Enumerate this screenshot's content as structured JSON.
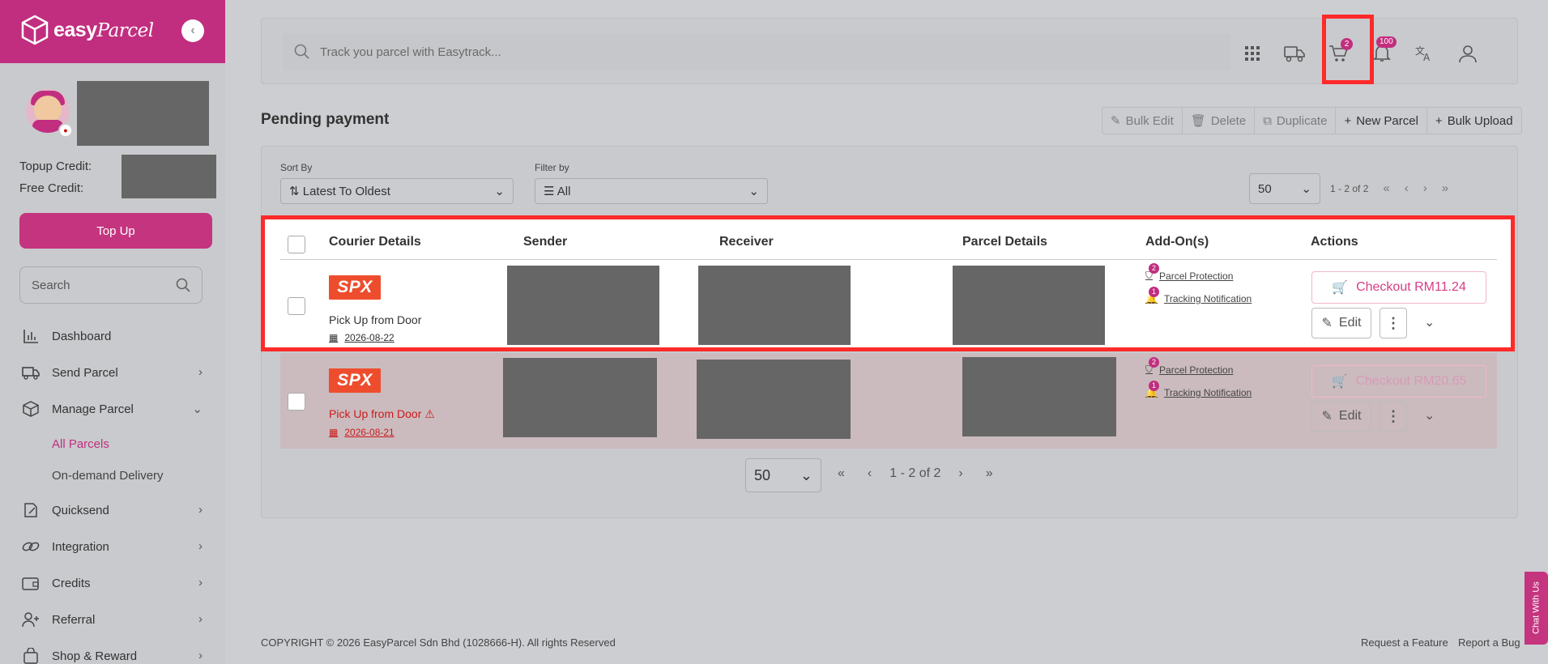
{
  "brand": {
    "name": "easyParcel",
    "name_plain": "easy",
    "name_italic": "Parcel"
  },
  "sidebar": {
    "topup_label": "Topup Credit:",
    "free_label": "Free Credit:",
    "topup_button": "Top Up",
    "search_placeholder": "Search",
    "nav": {
      "dashboard": "Dashboard",
      "send_parcel": "Send Parcel",
      "manage_parcel": "Manage Parcel",
      "all_parcels": "All Parcels",
      "on_demand": "On-demand Delivery",
      "quicksend": "Quicksend",
      "integration": "Integration",
      "credits": "Credits",
      "referral": "Referral",
      "shop_reward": "Shop & Reward"
    }
  },
  "topbar": {
    "search_placeholder": "Track you parcel with Easytrack...",
    "cart_count": "2",
    "notification_count": "100"
  },
  "page": {
    "title": "Pending payment",
    "toolbar": {
      "bulk_edit": "Bulk Edit",
      "delete": "Delete",
      "duplicate": "Duplicate",
      "new_parcel": "New Parcel",
      "bulk_upload": "Bulk Upload"
    }
  },
  "filters": {
    "sort_label": "Sort By",
    "sort_value": "Latest To Oldest",
    "filter_label": "Filter by",
    "filter_value": "All",
    "page_size": "50",
    "range": "1 - 2 of 2"
  },
  "table": {
    "headers": {
      "courier": "Courier Details",
      "sender": "Sender",
      "receiver": "Receiver",
      "parcel": "Parcel Details",
      "addons": "Add-On(s)",
      "actions": "Actions"
    },
    "rows": [
      {
        "courier": "SPX",
        "pickup": "Pick Up from Door",
        "date": "2026-08-22",
        "addon_protection": "Parcel Protection",
        "addon_protection_count": "2",
        "addon_tracking": "Tracking Notification",
        "addon_tracking_count": "1",
        "checkout": "Checkout RM11.24",
        "edit": "Edit"
      },
      {
        "courier": "SPX",
        "pickup": "Pick Up from Door",
        "date": "2026-08-21",
        "addon_protection": "Parcel Protection",
        "addon_protection_count": "2",
        "addon_tracking": "Tracking Notification",
        "addon_tracking_count": "1",
        "checkout": "Checkout RM20.65",
        "edit": "Edit"
      }
    ]
  },
  "pagination": {
    "page_size": "50",
    "range": "1 - 2 of 2"
  },
  "footer": {
    "copyright": "COPYRIGHT © 2026 EasyParcel Sdn Bhd (1028666-H). All rights Reserved",
    "request_feature": "Request a Feature",
    "report_bug": "Report a Bug"
  },
  "chat": "Chat With Us",
  "colors": {
    "brand": "#c12e7f",
    "highlight": "#ff2a2a",
    "courier": "#ee4d2d"
  }
}
